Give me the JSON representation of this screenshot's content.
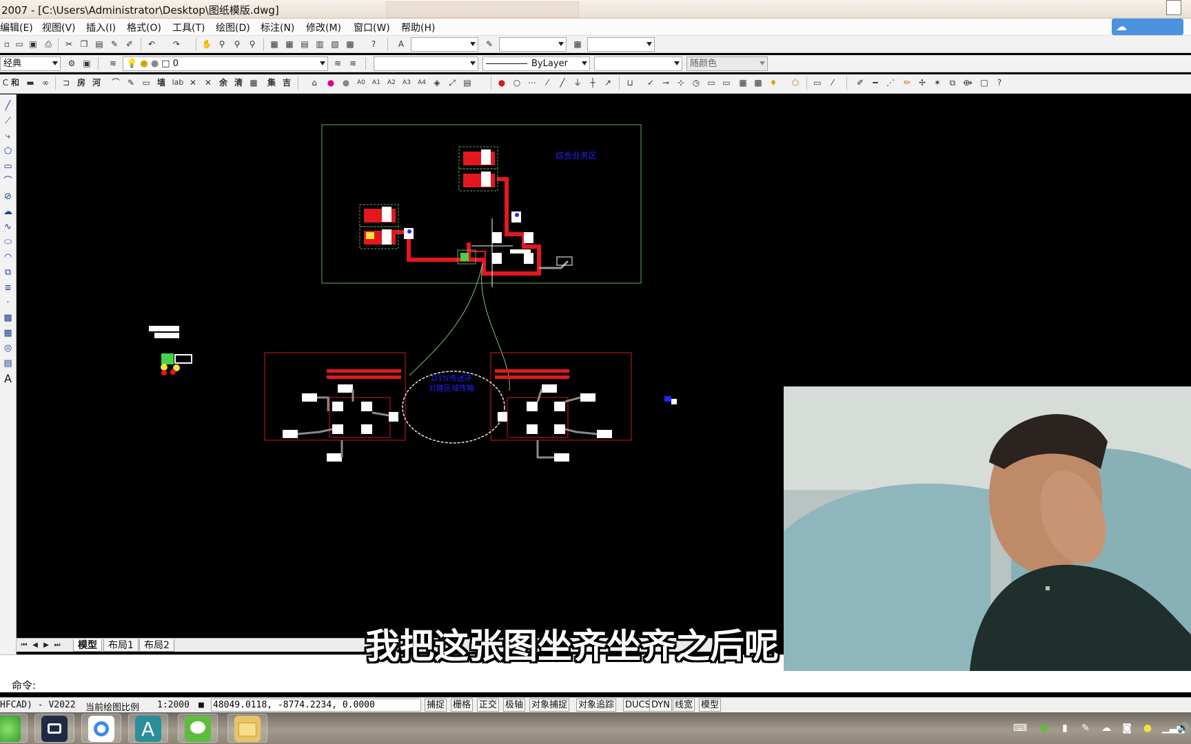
{
  "window": {
    "title": "2007 - [C:\\Users\\Administrator\\Desktop\\图纸模版.dwg]"
  },
  "menu": {
    "items": [
      "编辑(E)",
      "视图(V)",
      "插入(I)",
      "格式(O)",
      "工具(T)",
      "绘图(D)",
      "标注(N)",
      "修改(M)",
      "窗口(W)",
      "帮助(H)"
    ]
  },
  "toolbar2": {
    "style_combo": "经典",
    "layer_value": "0",
    "linetype_value": "ByLayer",
    "color_value": "随颜色"
  },
  "toolbar3": {
    "glyph_buttons": [
      "和",
      "房",
      "河",
      "墙",
      "lab",
      "余",
      "清",
      "集",
      "吉"
    ]
  },
  "drawing": {
    "labels": {
      "zone_top": "综合业务区",
      "cloud_line1": "DTN传送环",
      "cloud_line2": "对路区域传输"
    }
  },
  "layout_tabs": [
    "模型",
    "布局1",
    "布局2"
  ],
  "command": {
    "prompt": "命令:"
  },
  "status": {
    "app_version": "HFCAD) - V2022",
    "scale_label": "当前绘图比例",
    "scale_value": "1:2000",
    "coordinates": "48049.0118, -8774.2234, 0.0000",
    "toggles": [
      "捕捉",
      "栅格",
      "正交",
      "极轴",
      "对象捕捉",
      "对象追踪",
      "DUCS",
      "DYN",
      "线宽",
      "模型"
    ]
  },
  "subtitle": "我把这张图坐齐坐齐之后呢",
  "colors": {
    "frame_green": "#5fae5f",
    "frame_red": "#c81e1e",
    "pipe_red": "#e3181e",
    "label_blue": "#2323ff",
    "taskbar": "#8f8578"
  },
  "taskbar": {
    "apps": [
      "360-browser-icon",
      "zoom-video-icon",
      "baidu-netdisk-icon",
      "autocad-icon",
      "wechat-icon",
      "file-explorer-icon"
    ]
  }
}
